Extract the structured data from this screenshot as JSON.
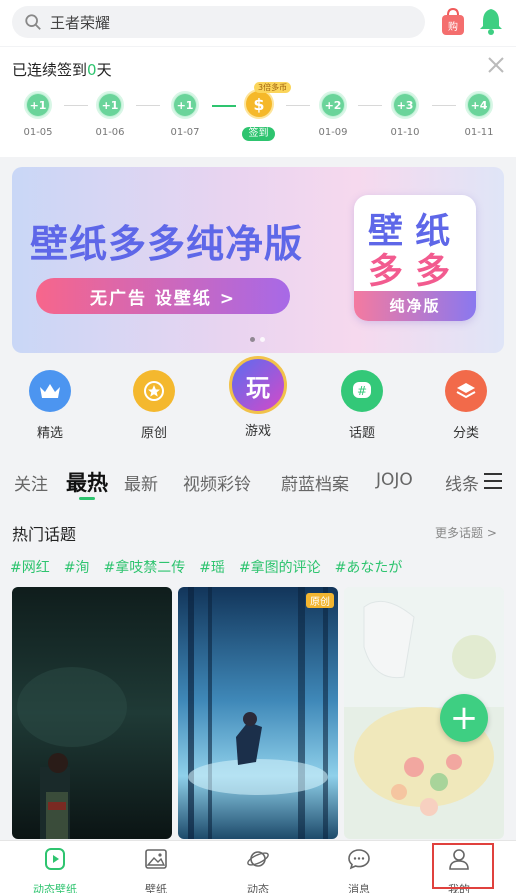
{
  "search": {
    "placeholder": "王者荣耀"
  },
  "signin": {
    "title_prefix": "已连续签到",
    "count": "0",
    "title_suffix": "天",
    "days": [
      {
        "reward": "+1",
        "date": "01-05"
      },
      {
        "reward": "+1",
        "date": "01-06"
      },
      {
        "reward": "+1",
        "date": "01-07"
      },
      {
        "reward": "$",
        "date": "签到",
        "tag": "3倍多币"
      },
      {
        "reward": "+2",
        "date": "01-09"
      },
      {
        "reward": "+3",
        "date": "01-10"
      },
      {
        "reward": "+4",
        "date": "01-11"
      }
    ]
  },
  "banner": {
    "headline": "壁纸多多纯净版",
    "button": "无广告 设壁纸 >",
    "logo_line1": "壁 纸",
    "logo_line2": "多 多",
    "logo_foot": "纯净版"
  },
  "categories": [
    {
      "label": "精选",
      "icon": "crown-icon",
      "color": "#4c95f0"
    },
    {
      "label": "原创",
      "icon": "star-icon",
      "color": "#f4b82e"
    },
    {
      "label": "游戏",
      "icon": "game-badge-icon",
      "color": "#7a3fd8"
    },
    {
      "label": "话题",
      "icon": "hashtag-icon",
      "color": "#33c878"
    },
    {
      "label": "分类",
      "icon": "layers-icon",
      "color": "#f26a4a"
    }
  ],
  "tabs": [
    "关注",
    "最热",
    "最新",
    "视频彩铃",
    "蔚蓝档案",
    "JOJO",
    "线条"
  ],
  "topics": {
    "title": "热门话题",
    "more": "更多话题 >",
    "tags": [
      "#网红",
      "#洵",
      "#拿吱禁二传",
      "#瑶",
      "#拿图的评论",
      "#あなたが"
    ]
  },
  "tiles": [
    {
      "badge": ""
    },
    {
      "badge": "原创"
    },
    {
      "badge": ""
    }
  ],
  "fab": "+",
  "nav": [
    {
      "label": "动态壁纸",
      "icon": "play-icon",
      "active": true
    },
    {
      "label": "壁纸",
      "icon": "image-icon"
    },
    {
      "label": "动态",
      "icon": "planet-icon"
    },
    {
      "label": "消息",
      "icon": "chat-icon"
    },
    {
      "label": "我的",
      "icon": "user-icon"
    }
  ]
}
